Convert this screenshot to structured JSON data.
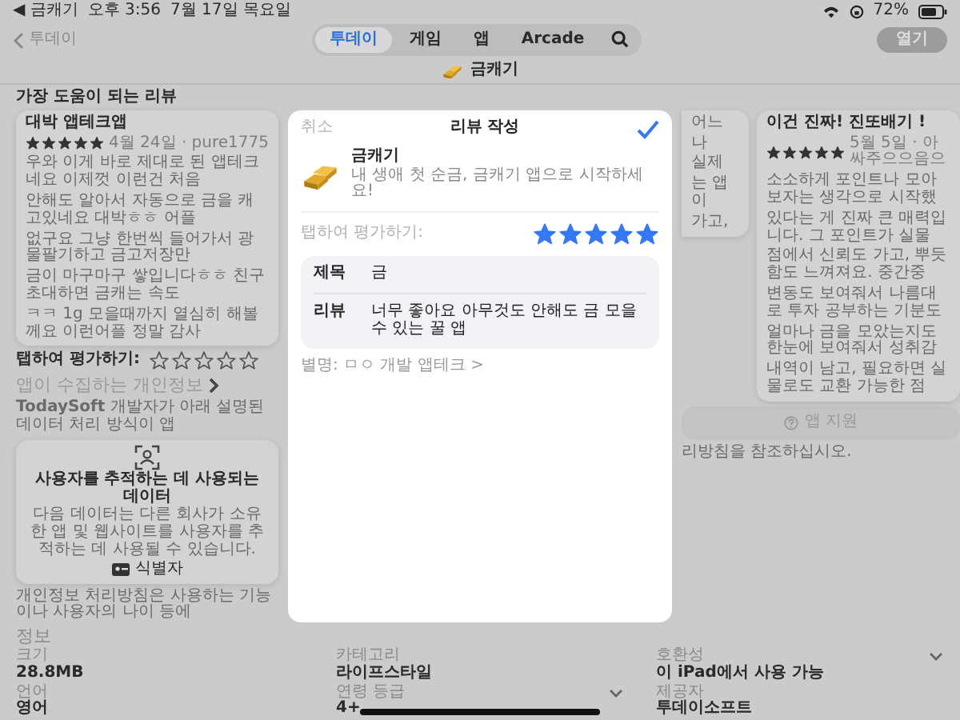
{
  "status_bar": {
    "back_app": "◀ 금캐기",
    "time": "오후 3:56",
    "date": "7월 17일 목요일",
    "battery": "72%"
  },
  "nav": {
    "back": "투데이",
    "tabs": [
      {
        "label": "투데이",
        "selected": true
      },
      {
        "label": "게임",
        "selected": false
      },
      {
        "label": "앱",
        "selected": false
      },
      {
        "label": "Arcade",
        "selected": false
      }
    ],
    "open_button": {
      "label": "열기",
      "disabled": true
    }
  },
  "app_title": "금캐기",
  "reviews": {
    "title": "가장 도움이 되는 리뷰",
    "items": [
      {
        "kind": "full",
        "title": "대박 앱테크앱",
        "stars": 5,
        "meta": "4월 24일 · pure1775",
        "body_lines": [
          "우와 이게 바로 제대로 된 앱테크네요 이제껏 이런건 처음",
          "안해도 알아서 자동으로 금을 캐고있네요 대박ㅎㅎ 어플",
          "없구요 그냥 한번씩 들어가서 광물팔기하고 금고저장만",
          "금이 마구마구 쌓입니다ㅎㅎ 친구 초대하면 금캐는 속도",
          "ㅋㅋ 1g 모을때까지 열심히 해볼께요 이런어플 정말 감사"
        ]
      },
      {
        "kind": "fragment",
        "body_lines": [
          "어느",
          "나",
          "실제",
          "는 앱이",
          "가고,"
        ]
      },
      {
        "kind": "full",
        "title": "이건 진짜! 진또배기 !",
        "stars": 5,
        "meta": "5월 5일 · 아싸주으으음으",
        "body_lines": [
          "소소하게 포인트나 모아보자는 생각으로 시작했",
          "있다는 게 진짜 큰 매력입니다. 그 포인트가 실물",
          "점에서 신뢰도 가고, 뿌듯함도 느껴져요. 중간중",
          "변동도 보여줘서 나름대로 투자 공부하는 기분도",
          "얼마나 금을 모았는지도 한눈에 보여줘서 성취감",
          "내역이 남고, 필요하면 실물로도 교환 가능한 점"
        ]
      }
    ]
  },
  "rate_prompt": {
    "label": "탭하여 평가하기:",
    "stars": 0
  },
  "support_button": {
    "label": "앱 지원"
  },
  "privacy": {
    "title": "앱이 수집하는 개인정보",
    "description_start": "**TodaySoft** 개발자가 아래 설명된 데이터 처리 방식이 앱",
    "description_end": "리방침을 참조하십시오.",
    "tracking_card": {
      "title": "사용자를 추적하는 데 사용되는 데이터",
      "description": "다음 데이터는 다른 회사가 소유한 앱 및 웹사이트를 사용자를 추적하는 데 사용될 수 있습니다.",
      "items": [
        "식별자"
      ]
    },
    "note": "개인정보 처리방침은 사용하는 기능이나 사용자의 나이 등에"
  },
  "modal": {
    "cancel": "취소",
    "title": "리뷰 작성",
    "app_name": "금캐기",
    "app_subtitle": "내 생애 첫 순금, 금캐기 앱으로 시작하세요!",
    "rate_label": "탭하여 평가하기:",
    "stars": 5,
    "fields": [
      {
        "label": "제목",
        "value": "금"
      },
      {
        "label": "리뷰",
        "value": "너무 좋아요 아무것도 안해도 금 모을 수 있는 꿀 앱"
      }
    ],
    "nickname": "별명: ㅁㅇ 개발 앱테크 >"
  },
  "info": {
    "title": "정보",
    "items": [
      {
        "label": "크기",
        "value": "28.8MB",
        "expandable": false
      },
      {
        "label": "카테고리",
        "value": "라이프스타일",
        "expandable": false
      },
      {
        "label": "호환성",
        "value": "이 iPad에서 사용 가능",
        "expandable": true
      },
      {
        "label": "언어",
        "value": "영어",
        "expandable": false
      },
      {
        "label": "연령 등급",
        "value": "4+",
        "expandable": true
      },
      {
        "label": "제공자",
        "value": "투데이소프트",
        "expandable": false
      }
    ]
  }
}
